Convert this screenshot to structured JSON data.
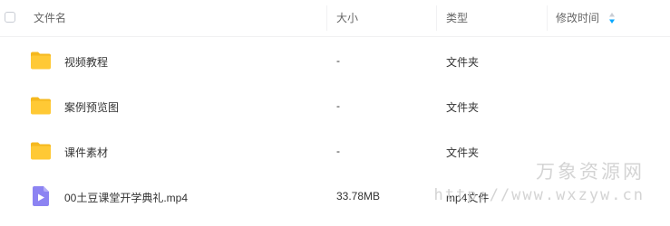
{
  "header": {
    "name_label": "文件名",
    "size_label": "大小",
    "type_label": "类型",
    "modified_label": "修改时间"
  },
  "files": [
    {
      "name": "视频教程",
      "size": "-",
      "type": "文件夹",
      "icon": "folder-icon"
    },
    {
      "name": "案例预览图",
      "size": "-",
      "type": "文件夹",
      "icon": "folder-icon"
    },
    {
      "name": "课件素材",
      "size": "-",
      "type": "文件夹",
      "icon": "folder-icon"
    },
    {
      "name": "00土豆课堂开学典礼.mp4",
      "size": "33.78MB",
      "type": "mp4文件",
      "icon": "video-file-icon"
    }
  ],
  "watermark": {
    "line1": "万象资源网",
    "line2": "http://www.wxzyw.cn"
  },
  "colors": {
    "folder": "#FFC935",
    "folder_back": "#F5B81E",
    "video_icon": "#8C83F2",
    "sort_up": "#C9CDD4",
    "sort_down": "#06A7FF"
  }
}
